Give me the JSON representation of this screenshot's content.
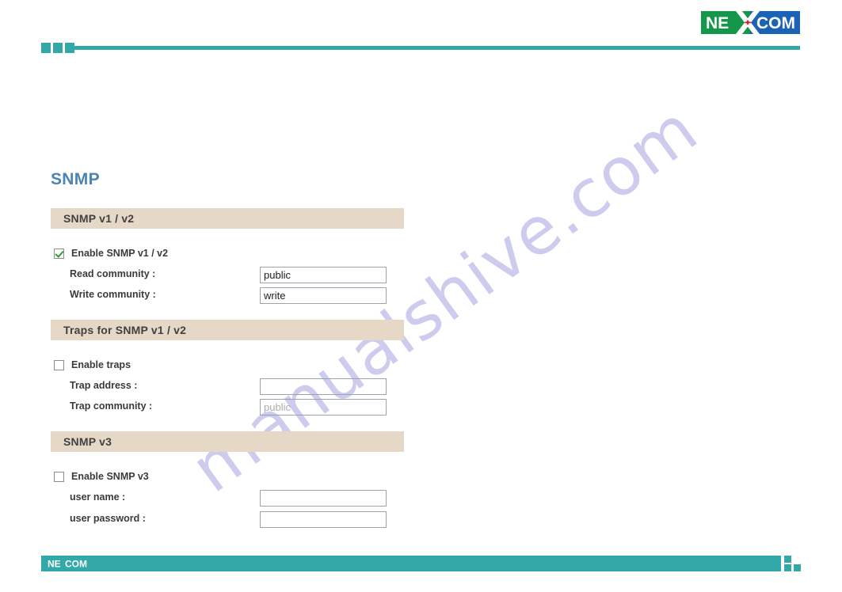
{
  "header": {
    "logo": {
      "name": "nexcom-logo",
      "text_left": "NE",
      "text_right": "COM",
      "green": "#14974b",
      "blue": "#1b63b5",
      "accent_red": "#e01b24"
    },
    "rule_color": "#33a8a8"
  },
  "watermark": {
    "text": "manualshive.com",
    "color": "#bcb9e8"
  },
  "main": {
    "page_title": "SNMP",
    "title_color": "#4a84b4",
    "section_bar_color": "#e6d8c7",
    "sections": [
      {
        "id": "snmp-v1-v2",
        "heading": "SNMP v1 / v2",
        "checkbox": {
          "label": "Enable SNMP v1 / v2",
          "checked": true
        },
        "fields": [
          {
            "label": "Read community :",
            "value": "public",
            "placeholder": ""
          },
          {
            "label": "Write community :",
            "value": "write",
            "placeholder": ""
          }
        ]
      },
      {
        "id": "traps-snmp-v1-v2",
        "heading": "Traps for SNMP v1 / v2",
        "checkbox": {
          "label": "Enable traps",
          "checked": false
        },
        "fields": [
          {
            "label": "Trap address :",
            "value": "",
            "placeholder": ""
          },
          {
            "label": "Trap community :",
            "value": "",
            "placeholder": "public"
          }
        ]
      },
      {
        "id": "snmp-v3",
        "heading": "SNMP v3",
        "checkbox": {
          "label": "Enable SNMP v3",
          "checked": false
        },
        "fields": [
          {
            "label": "user name :",
            "value": "",
            "placeholder": ""
          },
          {
            "label": "user password :",
            "value": "",
            "placeholder": ""
          }
        ]
      }
    ]
  },
  "footer": {
    "logo_text_left": "NE",
    "logo_text_right": "COM",
    "bar_color": "#33a8a8"
  }
}
